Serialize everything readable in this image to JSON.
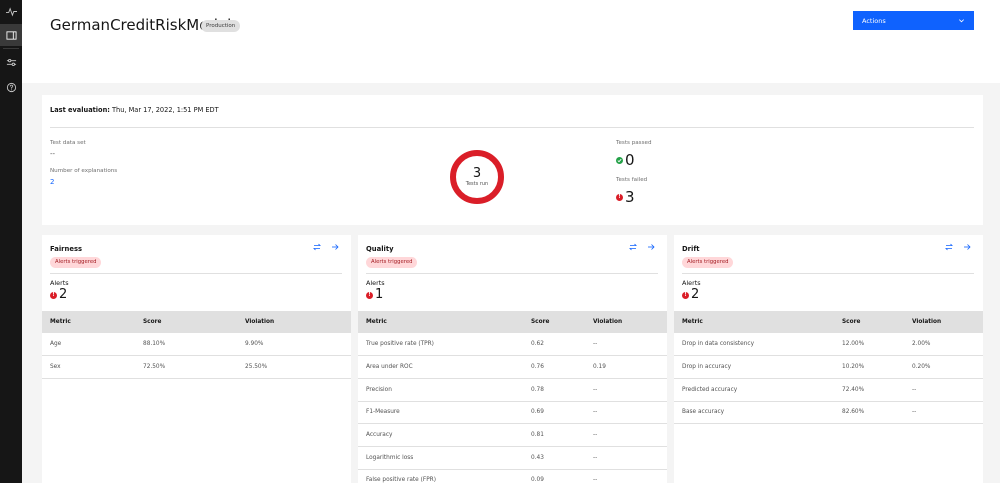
{
  "rail": {
    "icons": [
      "activity-icon",
      "panel-icon",
      "sliders-icon",
      "help-icon"
    ]
  },
  "header": {
    "title": "GermanCreditRiskModel",
    "tag": "Production",
    "actions_label": "Actions"
  },
  "evaluation": {
    "heading_label": "Last evaluation:",
    "heading_value": "Thu, Mar 17, 2022, 1:51 PM EDT",
    "test_data_set_label": "Test data set",
    "test_data_set_value": "--",
    "explanations_label": "Number of explanations",
    "explanations_value": "2",
    "tests_run_value": "3",
    "tests_run_label": "Tests run",
    "tests_passed_label": "Tests passed",
    "tests_passed_value": "0",
    "tests_failed_label": "Tests failed",
    "tests_failed_value": "3"
  },
  "cards": [
    {
      "title": "Fairness",
      "tag": "Alerts triggered",
      "alerts_label": "Alerts",
      "alerts_value": "2",
      "columns": [
        "Metric",
        "Score",
        "Violation"
      ],
      "rows": [
        [
          "Age",
          "88.10%",
          "9.90%"
        ],
        [
          "Sex",
          "72.50%",
          "25.50%"
        ]
      ]
    },
    {
      "title": "Quality",
      "tag": "Alerts triggered",
      "alerts_label": "Alerts",
      "alerts_value": "1",
      "columns": [
        "Metric",
        "Score",
        "Violation"
      ],
      "rows": [
        [
          "True positive rate (TPR)",
          "0.62",
          "--"
        ],
        [
          "Area under ROC",
          "0.76",
          "0.19"
        ],
        [
          "Precision",
          "0.78",
          "--"
        ],
        [
          "F1-Measure",
          "0.69",
          "--"
        ],
        [
          "Accuracy",
          "0.81",
          "--"
        ],
        [
          "Logarithmic loss",
          "0.43",
          "--"
        ],
        [
          "False positive rate (FPR)",
          "0.09",
          "--"
        ]
      ]
    },
    {
      "title": "Drift",
      "tag": "Alerts triggered",
      "alerts_label": "Alerts",
      "alerts_value": "2",
      "columns": [
        "Metric",
        "Score",
        "Violation"
      ],
      "rows": [
        [
          "Drop in data consistency",
          "12.00%",
          "2.00%"
        ],
        [
          "Drop in accuracy",
          "10.20%",
          "0.20%"
        ],
        [
          "Predicted accuracy",
          "72.40%",
          "--"
        ],
        [
          "Base accuracy",
          "82.60%",
          "--"
        ]
      ]
    }
  ],
  "colors": {
    "accent": "#0f62fe",
    "error": "#da1e28",
    "success": "#24a148",
    "alert_tag_bg": "#ffd7d9"
  }
}
